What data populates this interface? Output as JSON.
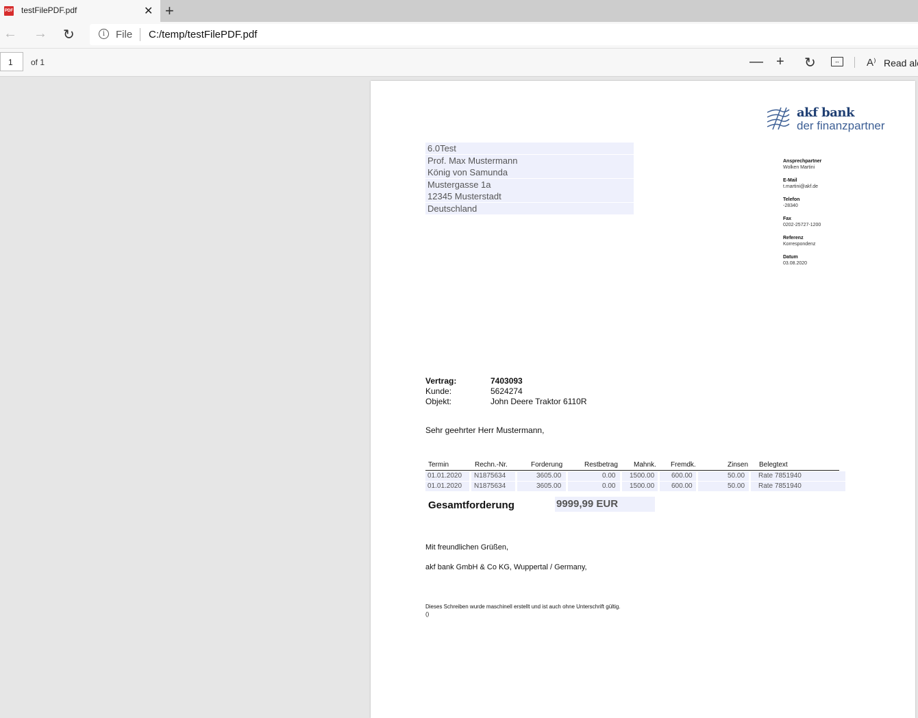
{
  "browser": {
    "tab_title": "testFilePDF.pdf",
    "tab_favicon_label": "PDF",
    "url_scheme": "File",
    "url": "C:/temp/testFilePDF.pdf"
  },
  "pdf_toolbar": {
    "page_number": "1",
    "page_of": "of 1",
    "read_aloud_label": "Read alo"
  },
  "document": {
    "logo": {
      "name": "akf bank",
      "subtitle": "der finanzpartner"
    },
    "address_lines": [
      "6.0Test",
      "Prof. Max Mustermann",
      "König von Samunda",
      "Mustergasse 1a",
      "12345 Musterstadt",
      "Deutschland"
    ],
    "contact": [
      {
        "label": "Ansprechpartner",
        "value": "Wolken Martini"
      },
      {
        "label": "E-Mail",
        "value": "t.martini@akf.de"
      },
      {
        "label": "Telefon",
        "value": "-28340"
      },
      {
        "label": "Fax",
        "value": "0202-25727-1200"
      },
      {
        "label": "Referenz",
        "value": "Korrespondenz"
      },
      {
        "label": "Datum",
        "value": "03.08.2020"
      }
    ],
    "reference": {
      "vertrag_label": "Vertrag:",
      "vertrag_value": "7403093",
      "kunde_label": "Kunde:",
      "kunde_value": "5624274",
      "objekt_label": "Objekt:",
      "objekt_value": "John Deere Traktor 6110R"
    },
    "salutation": "Sehr geehrter Herr Mustermann,",
    "table": {
      "headers": [
        "Termin",
        "Rechn.-Nr.",
        "Forderung",
        "Restbetrag",
        "Mahnk.",
        "Fremdk.",
        "Zinsen",
        "Belegtext"
      ],
      "rows": [
        [
          "01.01.2020",
          "N1875634",
          "3605.00",
          "0.00",
          "1500.00",
          "600.00",
          "50.00",
          "Rate 7851940"
        ],
        [
          "01.01.2020",
          "N1875634",
          "3605.00",
          "0.00",
          "1500.00",
          "600.00",
          "50.00",
          "Rate 7851940"
        ]
      ]
    },
    "total_label": "Gesamtforderung",
    "total_value": "9999,99 EUR",
    "closing": "Mit freundlichen Grüßen,",
    "company": "akf bank GmbH & Co KG, Wuppertal / Germany,",
    "footnote_line1": "Dieses Schreiben wurde maschinell erstellt und ist auch ohne Unterschrift gültig.",
    "footnote_line2": "()"
  }
}
